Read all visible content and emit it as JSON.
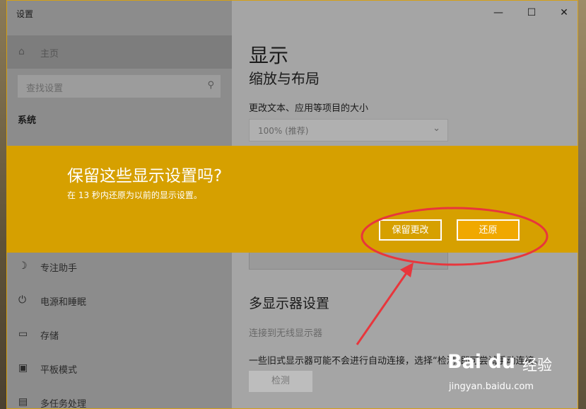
{
  "window": {
    "title": "设置",
    "minimize": "—",
    "maximize": "☐",
    "close": "✕"
  },
  "sidebar": {
    "home": {
      "icon": "home-icon",
      "label": "主页"
    },
    "search": {
      "placeholder": "查找设置"
    },
    "section": "系统",
    "items": [
      {
        "icon": "focus-assist-icon",
        "label": "专注助手"
      },
      {
        "icon": "power-icon",
        "label": "电源和睡眠"
      },
      {
        "icon": "storage-icon",
        "label": "存储"
      },
      {
        "icon": "tablet-icon",
        "label": "平板模式"
      },
      {
        "icon": "multitasking-icon",
        "label": "多任务处理"
      }
    ]
  },
  "main": {
    "title": "显示",
    "scale_heading": "缩放与布局",
    "scale_label": "更改文本、应用等项目的大小",
    "scale_value": "100% (推荐)",
    "multi_heading": "多显示器设置",
    "wireless_link": "连接到无线显示器",
    "note": "一些旧式显示器可能不会进行自动连接，选择“检测”即可尝试手动连接。",
    "detect_button": "检测"
  },
  "banner": {
    "title": "保留这些显示设置吗?",
    "subtitle": "在 13 秒内还原为以前的显示设置。",
    "keep_button": "保留更改",
    "revert_button": "还原"
  },
  "watermark": {
    "logo": "Bai du",
    "jingyan": "经验",
    "url": "jingyan.baidu.com"
  },
  "colors": {
    "banner": "#d6a000",
    "annotation": "#e8363c"
  }
}
